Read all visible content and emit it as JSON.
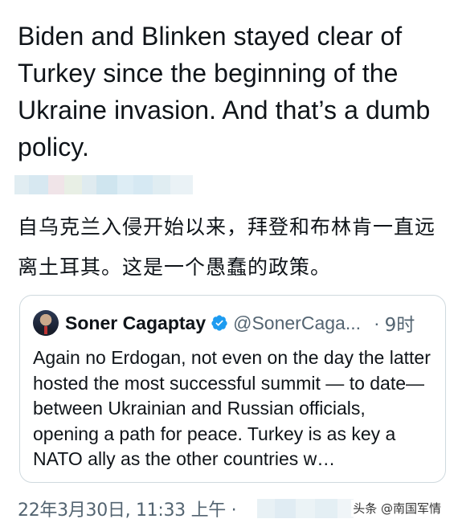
{
  "tweet": {
    "text": "Biden and Blinken stayed clear of Turkey since the beginning of the Ukraine invasion. And that’s a dumb policy.",
    "translation": "自乌克兰入侵开始以来，拜登和布林肯一直远离土耳其。这是一个愚蠢的政策。"
  },
  "quote": {
    "author_name": "Soner Cagaptay",
    "handle": "@SonerCaga...",
    "separator": "·",
    "time": "9时",
    "text": "Again no Erdogan, not even on the day the latter hosted the most successful summit — to date— between Ukrainian and Russian officials, opening a path for peace. Turkey is as key a NATO ally as the other countries w…"
  },
  "footer": {
    "datetime": "22年3月30日, 11:33 上午 ·"
  },
  "watermark": "头条 @南国军情",
  "colors": {
    "text_primary": "#0f1419",
    "text_secondary": "#536471",
    "card_border": "#cfd9de",
    "verified_blue": "#1d9bf0"
  }
}
